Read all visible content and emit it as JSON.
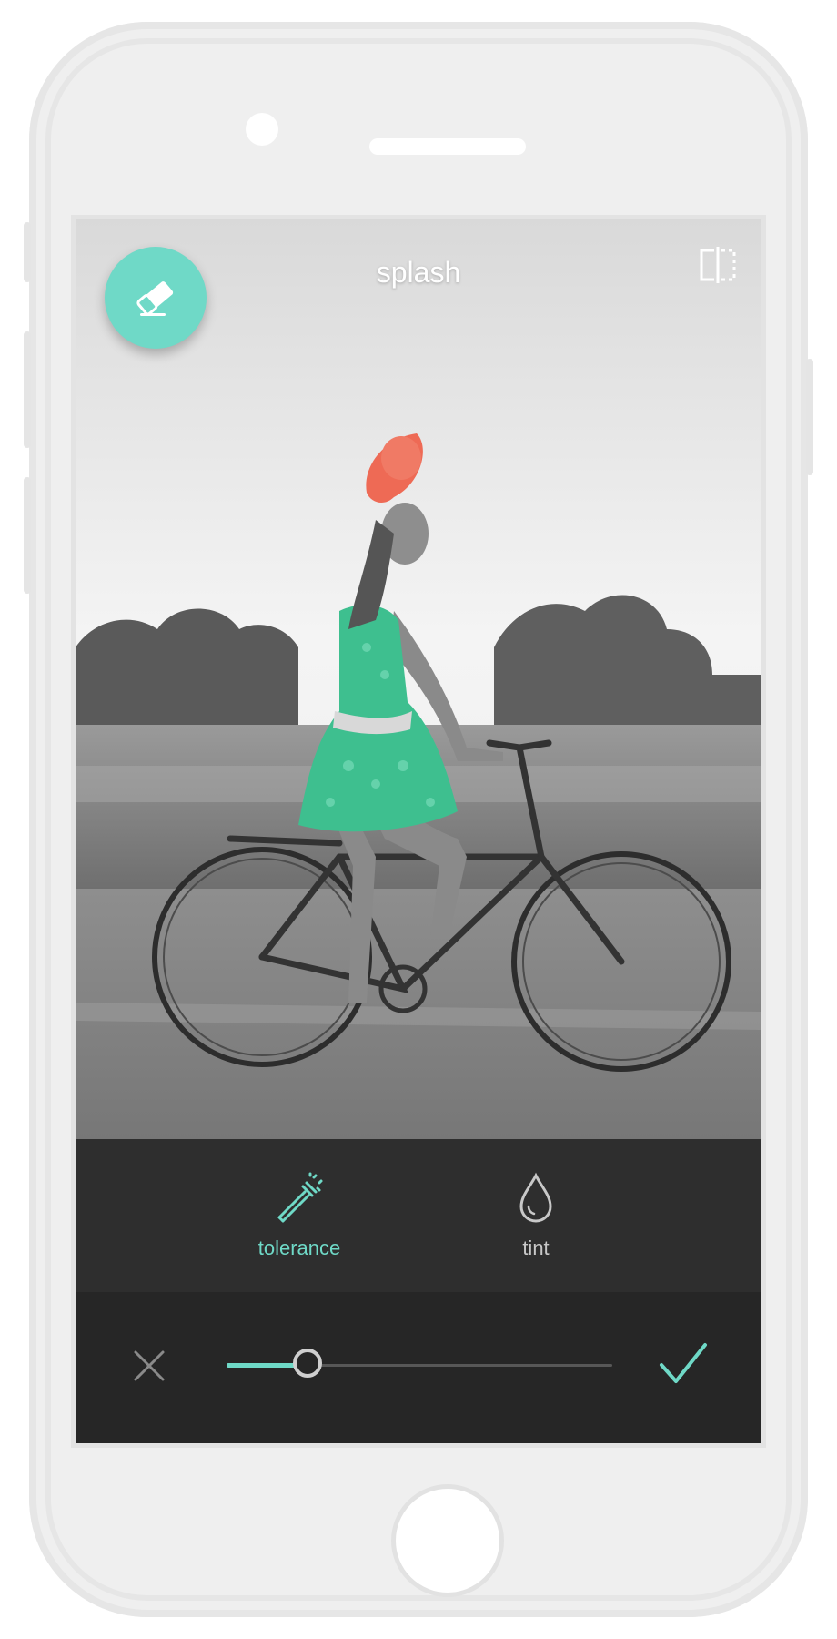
{
  "app": {
    "title": "splash"
  },
  "toolbar": {
    "eraser_icon": "eraser-icon",
    "compare_icon": "split-compare-icon"
  },
  "tools": [
    {
      "label": "tolerance",
      "icon": "magic-wand-icon",
      "active": true
    },
    {
      "label": "tint",
      "icon": "drop-icon",
      "active": false
    }
  ],
  "controls": {
    "cancel_icon": "close-icon",
    "confirm_icon": "check-icon",
    "slider_value": 0.21
  },
  "colors": {
    "accent": "#6fd9c7",
    "tool_strip": "#2e2e2e",
    "control_bar": "#262626"
  }
}
